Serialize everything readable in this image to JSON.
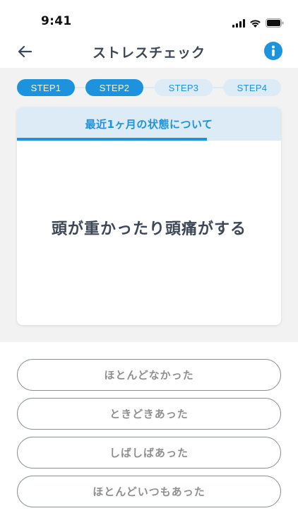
{
  "status_bar": {
    "time": "9:41",
    "icons": [
      "signal-icon",
      "wifi-icon",
      "battery-icon"
    ]
  },
  "nav": {
    "title": "ストレスチェック",
    "back_icon": "arrow-left-icon",
    "info_icon": "info-icon"
  },
  "steps": [
    {
      "label": "STEP1",
      "state": "active"
    },
    {
      "label": "STEP2",
      "state": "active"
    },
    {
      "label": "STEP3",
      "state": "inactive"
    },
    {
      "label": "STEP4",
      "state": "inactive"
    }
  ],
  "card": {
    "header": "最近1ヶ月の状態について",
    "progress": 0.72,
    "question": "頭が重かったり頭痛がする"
  },
  "answers": [
    {
      "label": "ほとんどなかった"
    },
    {
      "label": "ときどきあった"
    },
    {
      "label": "しばしばあった"
    },
    {
      "label": "ほとんどいつもあった"
    }
  ],
  "colors": {
    "accent": "#1c93dc",
    "accent_light": "#dcebf5",
    "text": "#3d4756",
    "muted": "#8f8f8f",
    "background": "#f2f2f2"
  }
}
